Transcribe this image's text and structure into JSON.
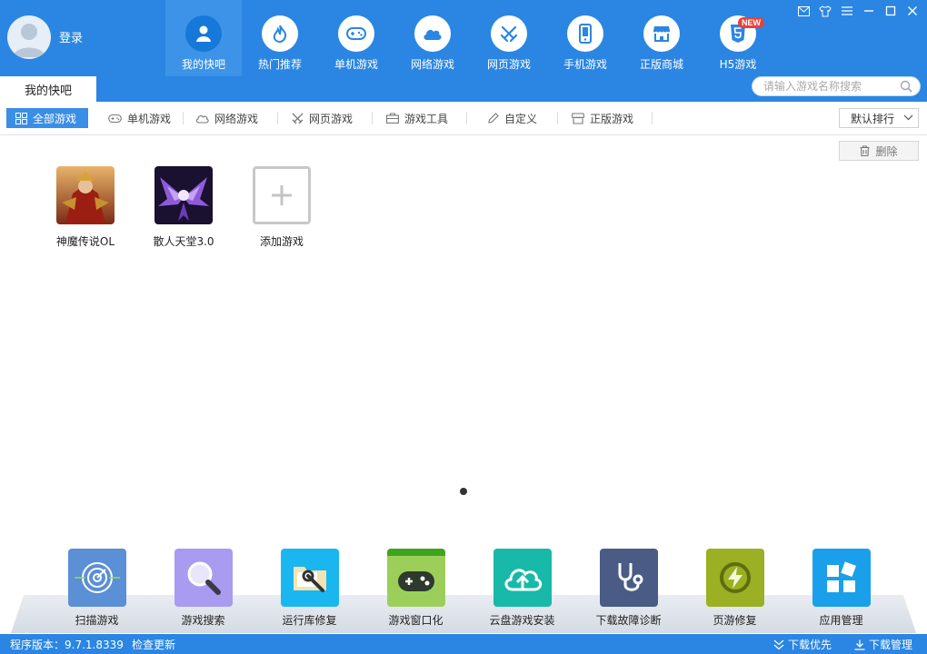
{
  "user": {
    "login_label": "登录",
    "avatar_icon": "user-avatar-icon"
  },
  "nav": {
    "items": [
      {
        "label": "我的快吧",
        "icon": "user-icon"
      },
      {
        "label": "热门推荐",
        "icon": "flame-icon"
      },
      {
        "label": "单机游戏",
        "icon": "gamepad-icon"
      },
      {
        "label": "网络游戏",
        "icon": "cloud-icon"
      },
      {
        "label": "网页游戏",
        "icon": "swords-icon"
      },
      {
        "label": "手机游戏",
        "icon": "phone-icon"
      },
      {
        "label": "正版商城",
        "icon": "store-icon"
      },
      {
        "label": "H5游戏",
        "icon": "html5-icon",
        "badge": "NEW"
      }
    ],
    "active_index": 0
  },
  "tab": {
    "label": "我的快吧"
  },
  "search": {
    "placeholder": "请输入游戏名称搜索"
  },
  "filters": [
    {
      "label": "全部游戏",
      "icon": "grid-icon"
    },
    {
      "label": "单机游戏",
      "icon": "gamepad-icon"
    },
    {
      "label": "网络游戏",
      "icon": "cloud-icon"
    },
    {
      "label": "网页游戏",
      "icon": "swords-icon"
    },
    {
      "label": "游戏工具",
      "icon": "toolbox-icon"
    },
    {
      "label": "自定义",
      "icon": "pencil-icon"
    },
    {
      "label": "正版游戏",
      "icon": "store-icon"
    }
  ],
  "sort": {
    "label": "默认排行"
  },
  "delete": {
    "label": "删除"
  },
  "games": [
    {
      "name": "神魔传说OL"
    },
    {
      "name": "散人天堂3.0"
    }
  ],
  "add_game": {
    "label": "添加游戏"
  },
  "tools": [
    {
      "label": "扫描游戏",
      "color": "#5b8fd6",
      "icon": "radar-icon"
    },
    {
      "label": "游戏搜索",
      "color": "#a99bf0",
      "icon": "magnifier-icon"
    },
    {
      "label": "运行库修复",
      "color": "#19b6f0",
      "icon": "folder-wrench-icon"
    },
    {
      "label": "游戏窗口化",
      "color": "#9ccf5a",
      "icon": "gamepad-icon"
    },
    {
      "label": "云盘游戏安装",
      "color": "#18b9a8",
      "icon": "cloud-upload-icon"
    },
    {
      "label": "下载故障诊断",
      "color": "#4a5b86",
      "icon": "stethoscope-icon"
    },
    {
      "label": "页游修复",
      "color": "#9bb022",
      "icon": "lightning-icon"
    },
    {
      "label": "应用管理",
      "color": "#1aa0ea",
      "icon": "apps-icon"
    }
  ],
  "status": {
    "version_label": "程序版本：9.7.1.8339",
    "check_update": "检查更新",
    "download_priority": "下载优先",
    "download_manager": "下载管理"
  },
  "colors": {
    "header": "#2a86e2",
    "accent": "#3a8ee6",
    "badge": "#e8413a"
  }
}
